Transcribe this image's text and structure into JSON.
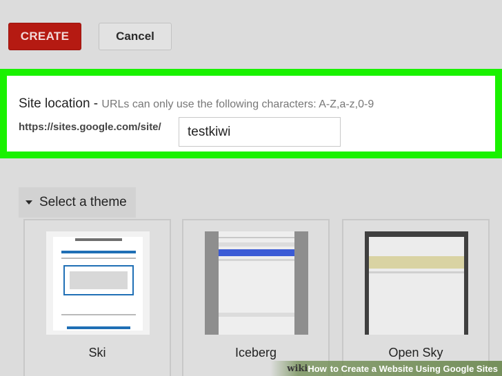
{
  "actions": {
    "create_label": "CREATE",
    "cancel_label": "Cancel"
  },
  "site_location": {
    "label": "Site location -",
    "hint": "URLs can only use the following characters: A-Z,a-z,0-9",
    "url_prefix": "https://sites.google.com/site/",
    "value": "testkiwi"
  },
  "themes": {
    "toggle_label": "Select a theme",
    "items": [
      {
        "name": "Ski"
      },
      {
        "name": "Iceberg"
      },
      {
        "name": "Open Sky"
      }
    ]
  },
  "watermark": {
    "brand_wiki": "wiki",
    "brand_how": "How",
    "title": "to Create a Website Using Google Sites"
  },
  "colors": {
    "highlight": "#19f100",
    "create_button": "#b51a12",
    "ski_accent": "#1f6fb5",
    "iceberg_accent": "#3b5bd6",
    "opensky_accent": "#d9d3a3"
  }
}
